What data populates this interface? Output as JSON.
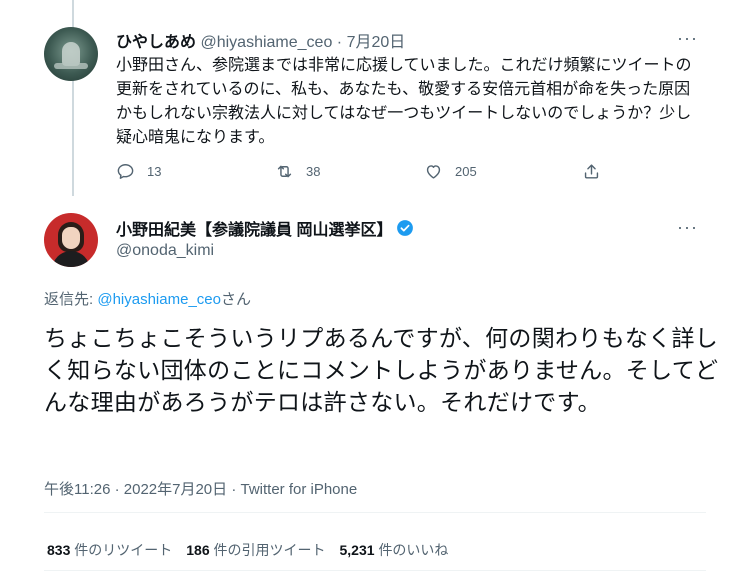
{
  "parent_tweet": {
    "display_name": "ひやしあめ",
    "handle": "@hiyashiame_ceo",
    "date": "7月20日",
    "more": "···",
    "text": "小野田さん、参院選までは非常に応援していました。これだけ頻繁にツイートの更新をされているのに、私も、あなたも、敬愛する安倍元首相が命を失った原因かもしれない宗教法人に対してはなぜ一つもツイートしないのでしょうか？少し疑心暗鬼になります。",
    "replies": "13",
    "retweets": "38",
    "likes": "205"
  },
  "main_tweet": {
    "display_name": "小野田紀美【参議院議員 岡山選挙区】",
    "handle": "@onoda_kimi",
    "more": "···",
    "reply_prefix": "返信先: ",
    "reply_to": "@hiyashiame_ceo",
    "reply_suffix": "さん",
    "text": "ちょこちょこそういうリプあるんですが、何の関わりもなく詳しく知らない団体のことにコメントしようがありません。そしてどんな理由があろうがテロは許さない。それだけです。",
    "timestamp": "午後11:26 · 2022年7月20日 · Twitter for iPhone",
    "stats": {
      "retweets_count": "833",
      "retweets_label": "件のリツイート",
      "quotes_count": "186",
      "quotes_label": "件の引用ツイート",
      "likes_count": "5,231",
      "likes_label": "件のいいね"
    }
  },
  "colors": {
    "accent": "#1d9bf0",
    "secondary_text": "#536471",
    "primary_text": "#0f1419"
  }
}
